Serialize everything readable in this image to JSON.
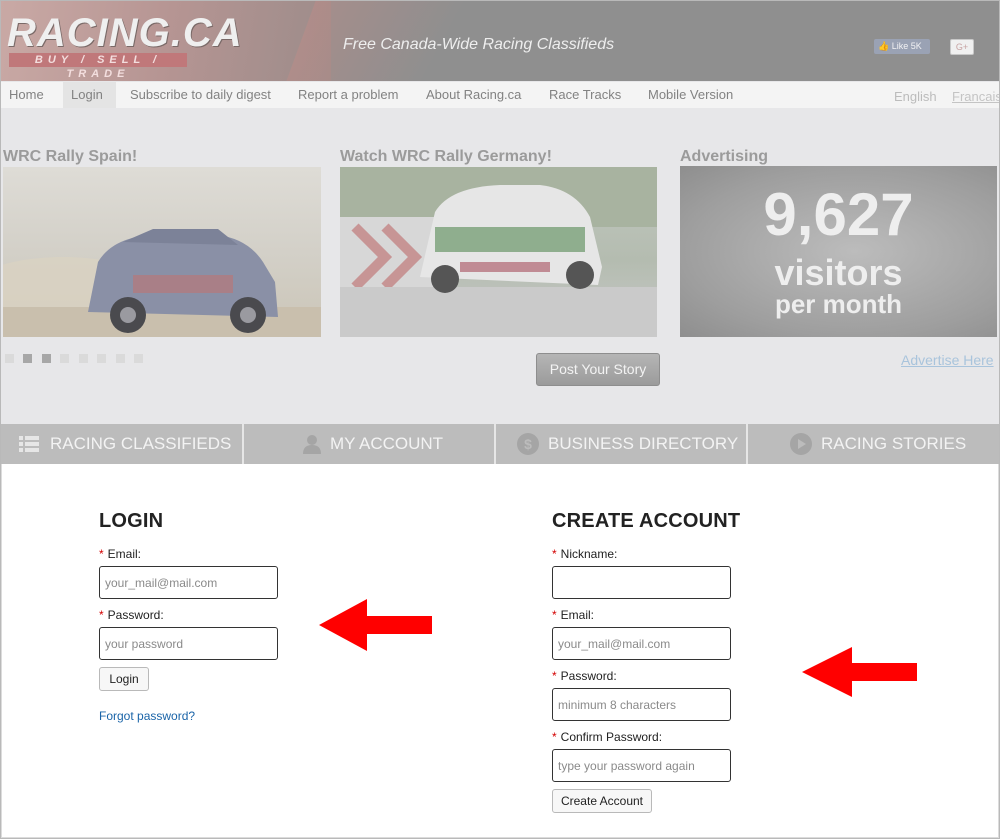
{
  "header": {
    "logo": "RACING.CA",
    "logo_sub": "BUY / SELL / TRADE",
    "tagline": "Free Canada-Wide Racing Classifieds",
    "like_label": "Like 5K",
    "gplus_label": "G+"
  },
  "nav": {
    "items": [
      {
        "label": "Home"
      },
      {
        "label": "Login"
      },
      {
        "label": "Subscribe to daily digest"
      },
      {
        "label": "Report a problem"
      },
      {
        "label": "About Racing.ca"
      },
      {
        "label": "Race Tracks"
      },
      {
        "label": "Mobile Version"
      }
    ],
    "active": "Login",
    "lang_english": "English",
    "lang_french": "Francais"
  },
  "stories": {
    "items": [
      {
        "title": "WRC Rally Spain!"
      },
      {
        "title": "Watch WRC Rally Germany!"
      }
    ],
    "advertising_title": "Advertising",
    "ad_number": "9,627",
    "ad_line2": "visitors",
    "ad_line3": "per month",
    "post_button": "Post Your Story",
    "advertise_link": "Advertise Here",
    "slider_active_index": 2
  },
  "tabs": [
    {
      "label": "RACING CLASSIFIEDS",
      "icon": "list-icon"
    },
    {
      "label": "MY ACCOUNT",
      "icon": "user-icon"
    },
    {
      "label": "BUSINESS DIRECTORY",
      "icon": "dollar-icon"
    },
    {
      "label": "RACING STORIES",
      "icon": "play-icon"
    }
  ],
  "login": {
    "title": "LOGIN",
    "email_label": "Email:",
    "email_placeholder": "your_mail@mail.com",
    "password_label": "Password:",
    "password_placeholder": "your password",
    "button": "Login",
    "forgot": "Forgot password?"
  },
  "create_account": {
    "title": "CREATE ACCOUNT",
    "nickname_label": "Nickname:",
    "nickname_value": "",
    "email_label": "Email:",
    "email_placeholder": "your_mail@mail.com",
    "password_label": "Password:",
    "password_placeholder": "minimum 8 characters",
    "confirm_label": "Confirm Password:",
    "confirm_placeholder": "type your password again",
    "button": "Create Account"
  },
  "colors": {
    "arrow": "#ff0000",
    "required": "#d30000",
    "link": "#1a64a8",
    "overlay": "#e7e7e9"
  }
}
